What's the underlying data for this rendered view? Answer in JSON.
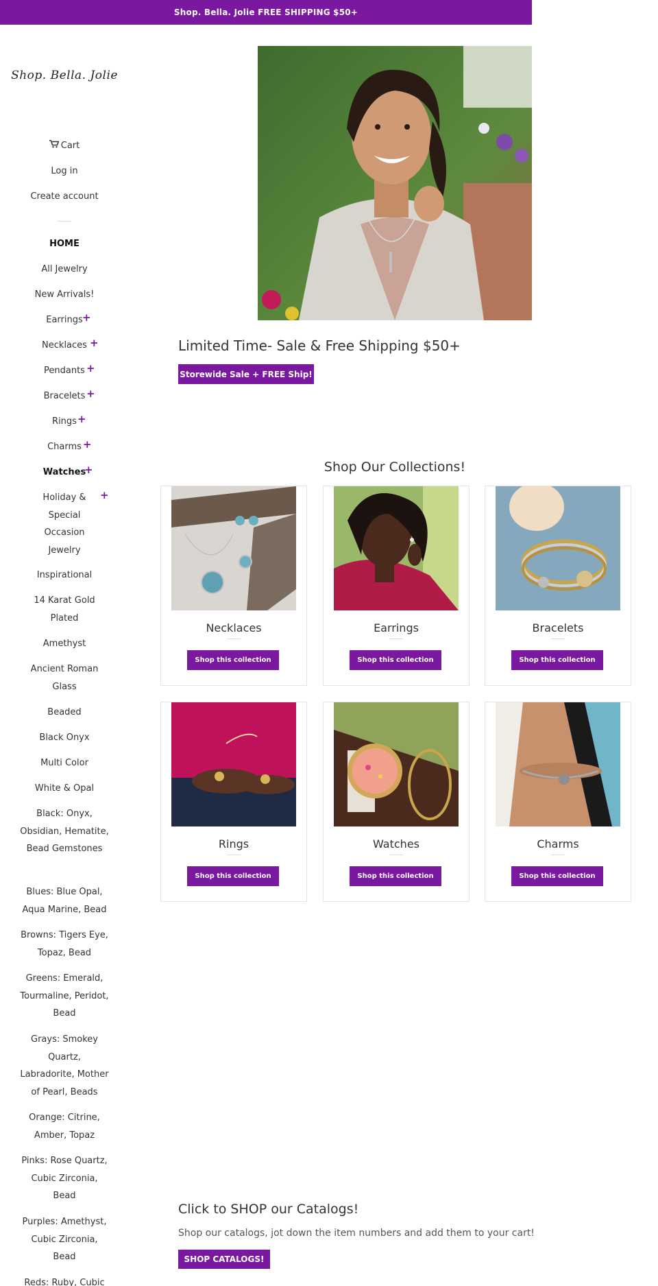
{
  "announcement": "Shop. Bella. Jolie FREE SHIPPING $50+",
  "logo": "Shop. Bella. Jolie",
  "account": {
    "cart": "Cart",
    "login": "Log in",
    "create": "Create account"
  },
  "nav": {
    "home": "HOME",
    "all": "All Jewelry",
    "new": "New Arrivals!",
    "earrings": "Earrings",
    "necklaces": "Necklaces",
    "pendants": "Pendants",
    "bracelets": "Bracelets",
    "rings": "Rings",
    "charms": "Charms",
    "watches": "Watches",
    "holiday": "Holiday & Special Occasion Jewelry",
    "inspirational": "Inspirational",
    "gold": "14 Karat Gold Plated",
    "amethyst": "Amethyst",
    "roman": "Ancient Roman Glass",
    "beaded": "Beaded",
    "onyx": "Black Onyx",
    "multicolor": "Multi Color",
    "white_opal": "White & Opal",
    "black_stones": "Black: Onyx, Obsidian, Hematite, Bead Gemstones",
    "blues": "Blues: Blue Opal, Aqua Marine, Bead",
    "browns": "Browns: Tigers Eye, Topaz, Bead",
    "greens": "Greens: Emerald, Tourmaline, Peridot, Bead",
    "grays": "Grays: Smokey Quartz, Labradorite, Mother of Pearl, Beads",
    "orange": "Orange: Citrine, Amber, Topaz",
    "pinks": "Pinks: Rose Quartz, Cubic Zirconia, Bead",
    "purples": "Purples: Amethyst, Cubic Zirconia, Bead",
    "reds": "Reds: Ruby, Cubic"
  },
  "hero": {
    "headline": "Limited Time- Sale & Free Shipping $50+",
    "button": "Storewide Sale + FREE Ship!"
  },
  "collections": {
    "title": "Shop Our Collections!",
    "button_label": "Shop this collection",
    "items": [
      "Necklaces",
      "Earrings",
      "Bracelets",
      "Rings",
      "Watches",
      "Charms"
    ]
  },
  "catalog": {
    "title": "Click to SHOP our Catalogs!",
    "text": "Shop our catalogs, jot down the item numbers and add them to your cart!",
    "button": "SHOP CATALOGS!"
  },
  "colors": {
    "brand_purple": "#7a18a0"
  }
}
